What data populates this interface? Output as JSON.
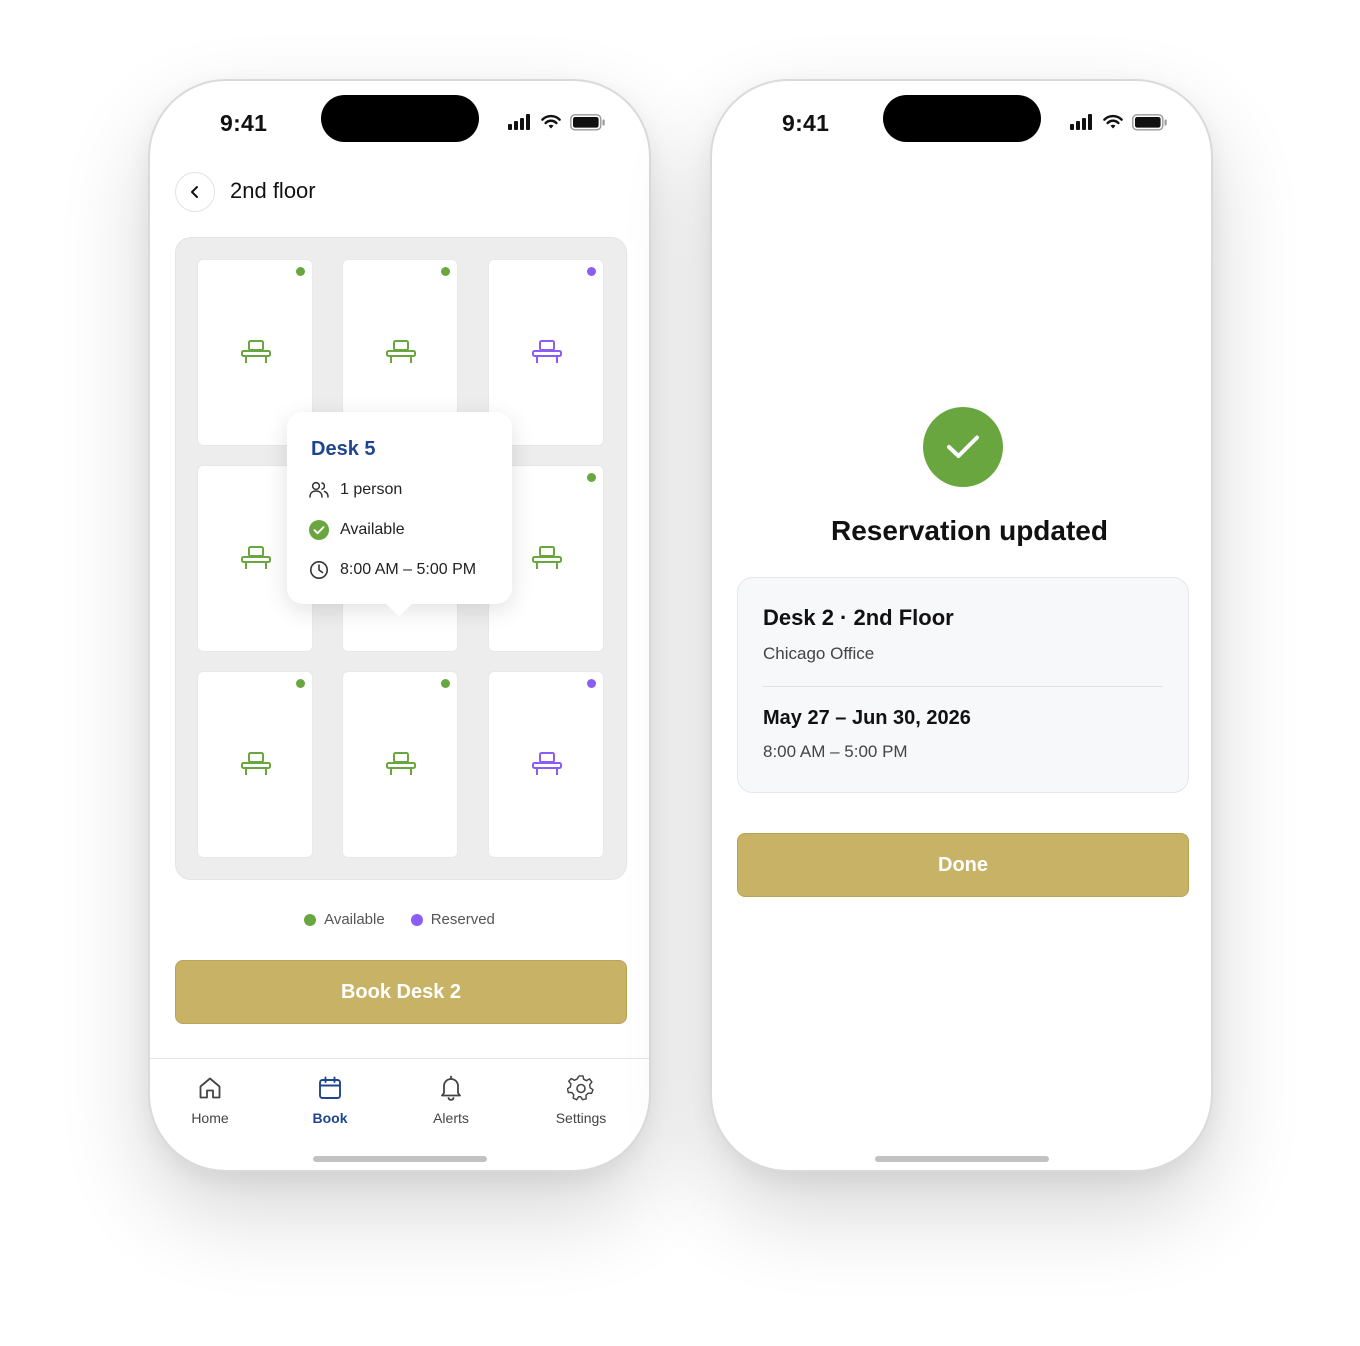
{
  "colors": {
    "available": "#6aa63f",
    "reserved": "#8b5cf6",
    "accent_button": "#c8b265",
    "brand_blue": "#1f4590"
  },
  "left_phone": {
    "status_bar": {
      "time": "9:41"
    },
    "header": {
      "back_icon": "chevron-left-icon",
      "title": "2nd floor"
    },
    "desks": [
      {
        "status": "available"
      },
      {
        "status": "available"
      },
      {
        "status": "reserved"
      },
      {
        "status": "available"
      },
      {
        "status": "available"
      },
      {
        "status": "available"
      },
      {
        "status": "available"
      },
      {
        "status": "available"
      },
      {
        "status": "reserved"
      }
    ],
    "tooltip": {
      "title": "Desk 5",
      "capacity": "1 person",
      "availability": "Available",
      "hours": "8:00 AM – 5:00 PM"
    },
    "legend": {
      "available": "Available",
      "reserved": "Reserved"
    },
    "book_button": "Book Desk 2",
    "tabs": [
      {
        "label": "Home",
        "icon": "home-icon",
        "active": false
      },
      {
        "label": "Book",
        "icon": "calendar-icon",
        "active": true
      },
      {
        "label": "Alerts",
        "icon": "bell-icon",
        "active": false
      },
      {
        "label": "Settings",
        "icon": "gear-icon",
        "active": false
      }
    ]
  },
  "right_phone": {
    "status_bar": {
      "time": "9:41"
    },
    "success_icon": "checkmark-icon",
    "title": "Reservation updated",
    "summary": {
      "desk": "Desk 2 · 2nd Floor",
      "location": "Chicago Office",
      "dates": "May 27 – Jun 30, 2026",
      "hours": "8:00 AM – 5:00 PM"
    },
    "done_button": "Done"
  }
}
